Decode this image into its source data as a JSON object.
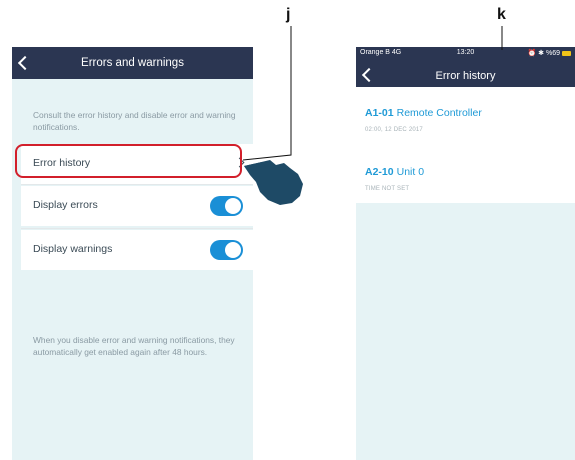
{
  "callouts": {
    "left_label": "j",
    "right_label": "k"
  },
  "left_screen": {
    "title": "Errors and warnings",
    "intro": "Consult the error history and disable error and warning notifications.",
    "rows": [
      {
        "label": "Error history",
        "control": "chevron"
      },
      {
        "label": "Display errors",
        "control": "toggle",
        "state": "on"
      },
      {
        "label": "Display warnings",
        "control": "toggle",
        "state": "on"
      }
    ],
    "footer": "When you disable error and warning notifications, they automatically get enabled again after 48 hours."
  },
  "right_screen": {
    "status_bar": {
      "carrier": "Orange B  4G",
      "time": "13:20",
      "right": "⏰ ✱ %69"
    },
    "title": "Error history",
    "errors": [
      {
        "code": "A1-01",
        "name": "Remote Controller",
        "time": "02:00, 12 DEC 2017"
      },
      {
        "code": "A2-10",
        "name": "Unit 0",
        "time": "TIME NOT SET"
      }
    ]
  },
  "colors": {
    "navbar": "#2b3652",
    "background": "#e6f3f5",
    "toggle_on": "#1a8fd6",
    "error_text": "#1f9ad6",
    "highlight": "#d21f2b",
    "hand": "#1e4a66"
  },
  "icons": [
    "back-chevron-icon",
    "chevron-right-icon",
    "toggle-switch",
    "pointing-hand-icon",
    "battery-icon"
  ]
}
